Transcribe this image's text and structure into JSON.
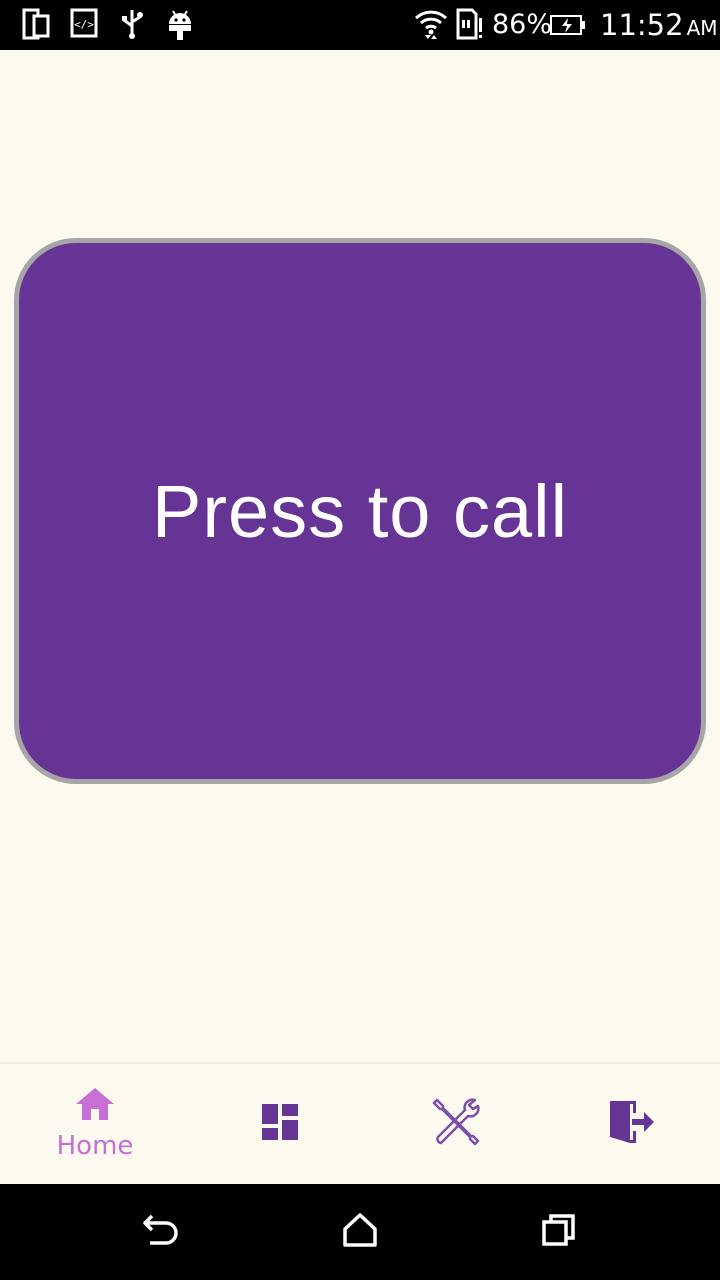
{
  "status_bar": {
    "battery_percent": "86%",
    "time": "11:52",
    "am_pm": "AM",
    "icons": [
      "screen-rotate-icon",
      "developer-code-icon",
      "usb-icon",
      "android-debug-icon",
      "wifi-icon",
      "sim-alert-icon",
      "battery-charging-icon"
    ]
  },
  "main": {
    "call_button_label": "Press to call"
  },
  "bottom_nav": {
    "items": [
      {
        "icon": "home-icon",
        "label": "Home",
        "active": true
      },
      {
        "icon": "dashboard-icon",
        "label": ""
      },
      {
        "icon": "tools-icon",
        "label": ""
      },
      {
        "icon": "logout-icon",
        "label": ""
      }
    ]
  },
  "system_nav": {
    "buttons": [
      "back-icon",
      "home-outline-icon",
      "recents-icon"
    ]
  },
  "colors": {
    "background": "#FCF9EE",
    "primary": "#653495",
    "active_accent": "#C86FD4",
    "button_border": "#A7A5A7"
  }
}
